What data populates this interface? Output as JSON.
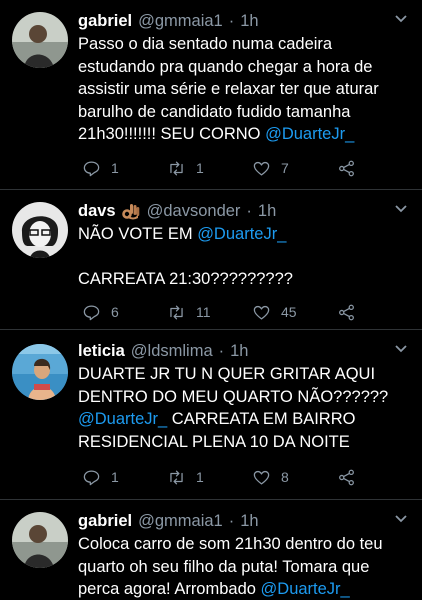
{
  "tweets": [
    {
      "name": "gabriel",
      "handle": "@gmmaia1",
      "time": "1h",
      "text": "Passo o dia sentado numa cadeira estudando pra quando chegar a hora de assistir uma série e relaxar ter que aturar barulho de candidato fudido tamanha 21h30!!!!!!! SEU CORNO ",
      "mention": "@DuarteJr_",
      "tail": "",
      "replies": "1",
      "retweets": "1",
      "likes": "7"
    },
    {
      "name": "davs",
      "emoji": "ok-hand-emoji",
      "handle": "@davsonder",
      "time": "1h",
      "text": "NÃO VOTE EM ",
      "mention": "@DuarteJr_",
      "tail": "\n\nCARREATA 21:30?????????",
      "replies": "6",
      "retweets": "11",
      "likes": "45"
    },
    {
      "name": "leticia",
      "handle": "@ldsmlima",
      "time": "1h",
      "text": "DUARTE JR TU N QUER GRITAR AQUI DENTRO DO MEU QUARTO NÃO??????\n",
      "mention": "@DuarteJr_",
      "tail": " CARREATA EM BAIRRO RESIDENCIAL PLENA 10 DA NOITE",
      "replies": "1",
      "retweets": "1",
      "likes": "8"
    },
    {
      "name": "gabriel",
      "handle": "@gmmaia1",
      "time": "1h",
      "text": "Coloca carro de som 21h30 dentro do teu quarto oh seu filho da puta! Tomara que perca agora! Arrombado ",
      "mention": "@DuarteJr_",
      "tail": ""
    }
  ],
  "separator": "·",
  "colors": {
    "background": "#000000",
    "text": "#ffffff",
    "secondary": "#8b98a5",
    "mention": "#1d9bf0",
    "divider": "#2f3336"
  }
}
